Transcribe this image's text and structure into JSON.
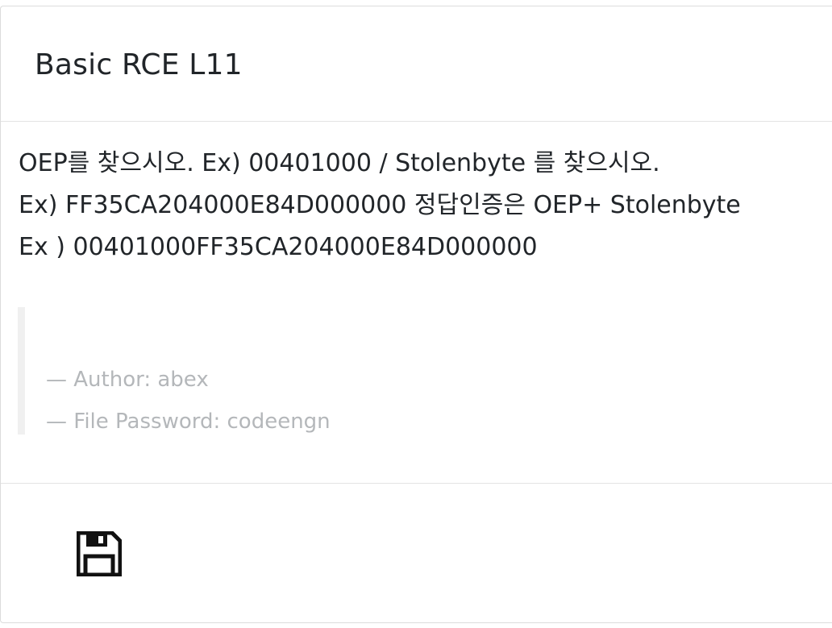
{
  "card": {
    "title": "Basic RCE L11",
    "description": "OEP를 찾으시오. Ex) 00401000 / Stolenbyte 를 찾으시오.\nEx) FF35CA204000E84D000000 정답인증은 OEP+ Stolenbyte\nEx ) 00401000FF35CA204000E84D000000",
    "meta": {
      "author_line": "— Author: abex",
      "password_line": "— File Password: codeengn"
    }
  },
  "footer": {
    "save_icon": "floppy-disk-icon"
  }
}
